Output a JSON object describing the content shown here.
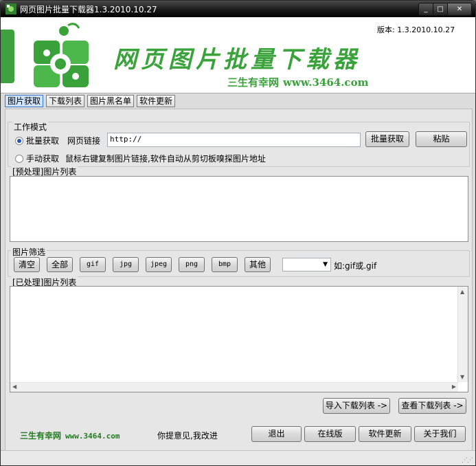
{
  "window": {
    "title": "网页图片批量下载器1.3.2010.10.27",
    "controls": [
      "_",
      "□",
      "✕"
    ]
  },
  "banner": {
    "title": "网页图片批量下载器",
    "slogan": "三生有幸网",
    "slogan_url": "www.3464.com",
    "version": "版本: 1.3.2010.10.27"
  },
  "tabs": [
    "图片获取",
    "下载列表",
    "图片黑名单",
    "软件更新"
  ],
  "work_mode": {
    "label": "工作模式",
    "batch_radio": "批量获取",
    "url_label": "网页链接",
    "url_value": "http://",
    "fetch_button": "批量获取",
    "paste_button": "粘贴",
    "manual_radio": "手动获取",
    "manual_hint": "鼠标右键复制图片链接,软件自动从剪切板嗅探图片地址"
  },
  "preprocess_list": {
    "label": "[预处理]图片列表"
  },
  "filter": {
    "label": "图片筛选",
    "buttons": [
      "清空",
      "全部",
      "gif",
      "jpg",
      "jpeg",
      "png",
      "bmp",
      "其他"
    ],
    "combo_value": "",
    "hint": "如:gif或.gif"
  },
  "processed_list": {
    "label": "[已处理]图片列表"
  },
  "actions": {
    "import_button": "导入下载列表 ->",
    "view_button": "查看下载列表 ->"
  },
  "footer": {
    "site_name": "三生有幸网",
    "site_url": "www.3464.com",
    "suggestion": "你提意见,我改进",
    "buttons": [
      "退出",
      "在线版",
      "软件更新",
      "关于我们"
    ]
  },
  "colors": {
    "brand_green": "#3aa23a",
    "footer_green": "#237a23",
    "titlebar": "#1a1a1a"
  }
}
